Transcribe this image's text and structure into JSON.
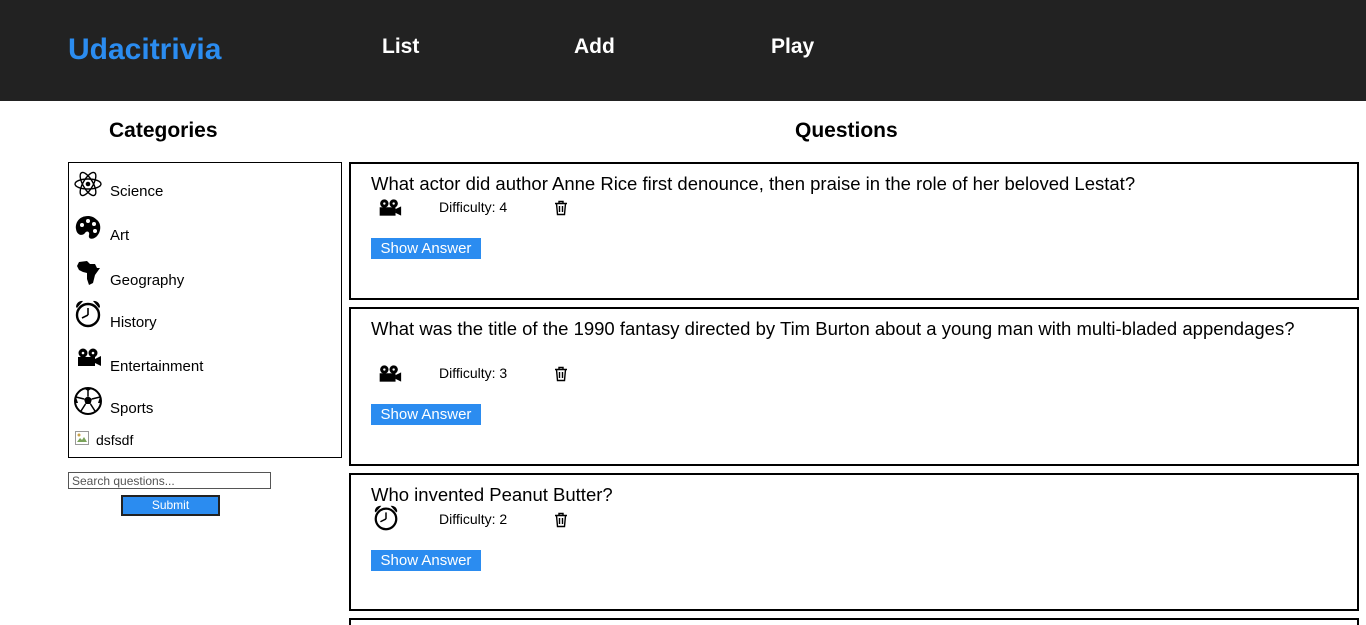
{
  "header": {
    "brand": "Udacitrivia",
    "nav": [
      {
        "label": "List"
      },
      {
        "label": "Add"
      },
      {
        "label": "Play"
      }
    ]
  },
  "categories_panel": {
    "title": "Categories",
    "items": [
      {
        "label": "Science",
        "icon": "atom-icon"
      },
      {
        "label": "Art",
        "icon": "palette-icon"
      },
      {
        "label": "Geography",
        "icon": "africa-map-icon"
      },
      {
        "label": "History",
        "icon": "alarm-clock-icon"
      },
      {
        "label": "Entertainment",
        "icon": "film-camera-icon"
      },
      {
        "label": "Sports",
        "icon": "soccer-ball-icon"
      },
      {
        "label": "dsfsdf",
        "icon": "broken-image-icon"
      }
    ],
    "search": {
      "placeholder": "Search questions...",
      "submit_label": "Submit"
    }
  },
  "questions_panel": {
    "title": "Questions",
    "questions": [
      {
        "text": "What actor did author Anne Rice first denounce, then praise in the role of her beloved Lestat?",
        "category_icon": "film-camera-icon",
        "difficulty": "Difficulty: 4",
        "show_answer": "Show Answer"
      },
      {
        "text": "What was the title of the 1990 fantasy directed by Tim Burton about a young man with multi-bladed appendages?",
        "category_icon": "film-camera-icon",
        "difficulty": "Difficulty: 3",
        "show_answer": "Show Answer"
      },
      {
        "text": "Who invented Peanut Butter?",
        "category_icon": "alarm-clock-icon",
        "difficulty": "Difficulty: 2",
        "show_answer": "Show Answer"
      }
    ]
  },
  "colors": {
    "header_bg": "#222222",
    "accent": "#2b8cf0"
  }
}
